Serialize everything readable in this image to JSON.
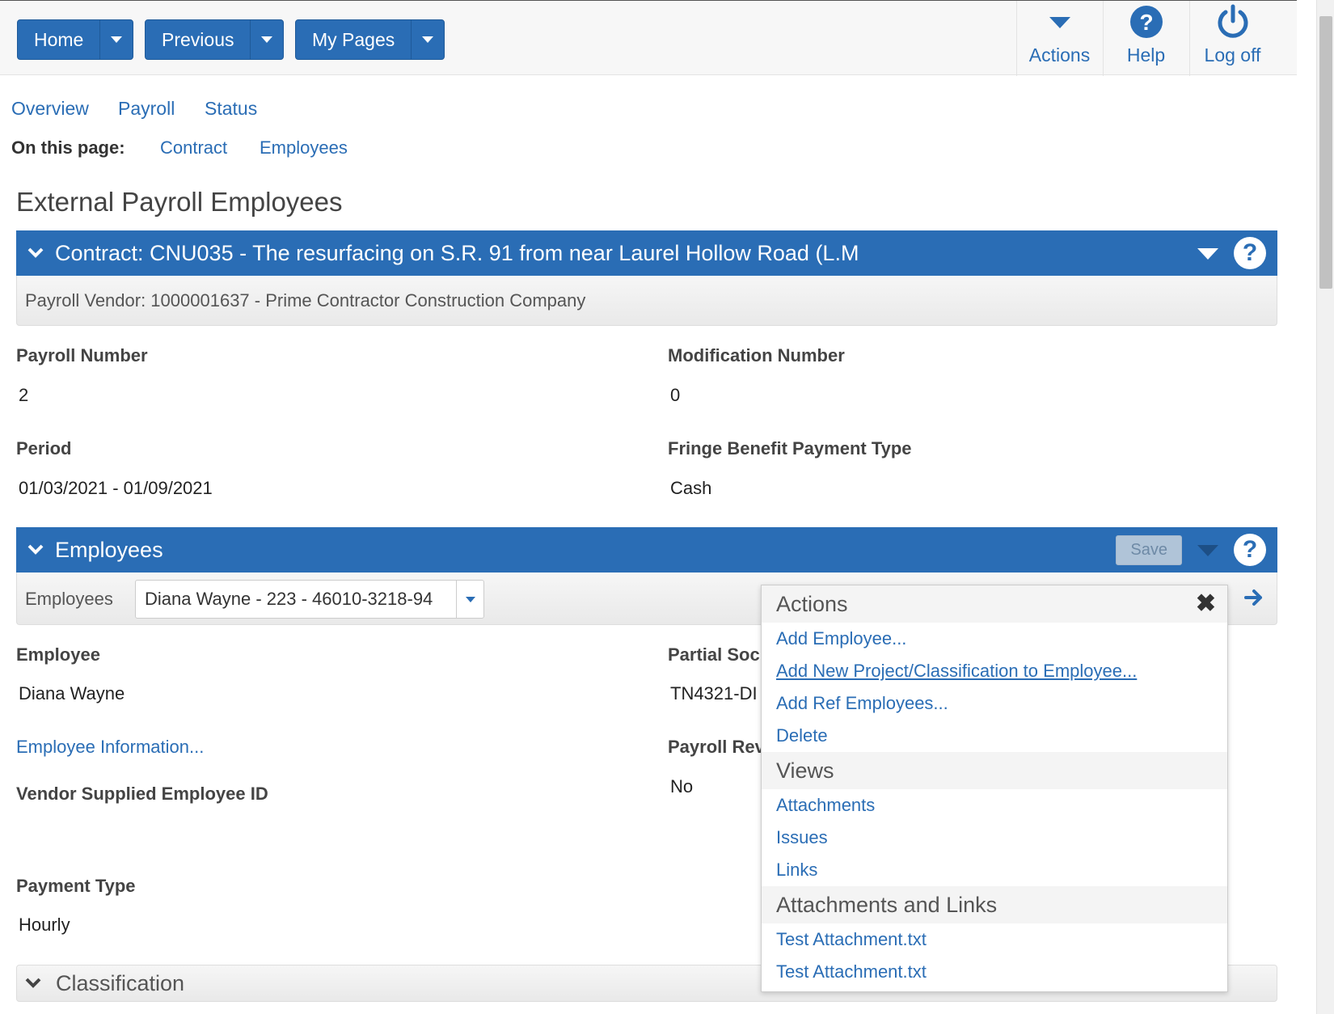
{
  "topnav": {
    "home_label": "Home",
    "previous_label": "Previous",
    "mypages_label": "My Pages",
    "actions_label": "Actions",
    "help_label": "Help",
    "logoff_label": "Log off"
  },
  "tabs": [
    "Overview",
    "Payroll",
    "Status"
  ],
  "on_this_page": {
    "label": "On this page:",
    "links": [
      "Contract",
      "Employees"
    ]
  },
  "page_title": "External Payroll Employees",
  "contract_panel": {
    "title": "Contract: CNU035 - The resurfacing on S.R. 91 from near Laurel Hollow Road (L.M",
    "vendor": "Payroll Vendor: 1000001637 - Prime Contractor Construction Company"
  },
  "fields": {
    "payroll_number_label": "Payroll Number",
    "payroll_number_value": "2",
    "modification_number_label": "Modification Number",
    "modification_number_value": "0",
    "period_label": "Period",
    "period_value": "01/03/2021 - 01/09/2021",
    "fringe_label": "Fringe Benefit Payment Type",
    "fringe_value": "Cash"
  },
  "employees_panel": {
    "title": "Employees",
    "save_label": "Save",
    "selector_label": "Employees",
    "selector_value": "Diana Wayne - 223 - 46010-3218-94"
  },
  "employee": {
    "employee_label": "Employee",
    "employee_value": "Diana Wayne",
    "partial_ssn_label": "Partial Soc",
    "partial_ssn_value": "TN4321-DI",
    "employee_info_link": "Employee Information...",
    "payroll_rev_label": "Payroll Rev",
    "payroll_rev_value": "No",
    "vendor_id_label": "Vendor Supplied Employee ID",
    "payment_type_label": "Payment Type",
    "payment_type_value": "Hourly"
  },
  "classification_panel": {
    "title": "Classification"
  },
  "actions_menu": {
    "actions_header": "Actions",
    "actions_items": [
      "Add Employee...",
      "Add New Project/Classification to Employee...",
      "Add Ref Employees...",
      "Delete"
    ],
    "views_header": "Views",
    "views_items": [
      "Attachments",
      "Issues",
      "Links"
    ],
    "attach_header": "Attachments and Links",
    "attach_items": [
      "Test Attachment.txt",
      "Test Attachment.txt"
    ]
  },
  "colors": {
    "brand_blue": "#2a6db5"
  }
}
